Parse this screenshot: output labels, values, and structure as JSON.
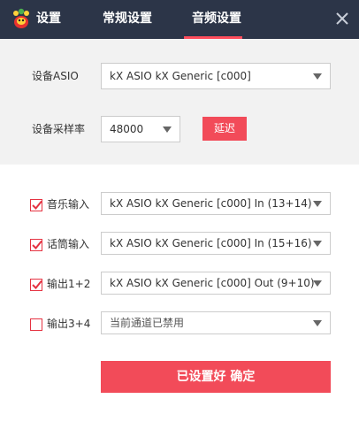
{
  "header": {
    "tabs": [
      {
        "label": "设置"
      },
      {
        "label": "常规设置"
      },
      {
        "label": "音频设置",
        "active": true
      }
    ]
  },
  "device": {
    "asio_label": "设备ASIO",
    "asio_value": "kX ASIO kX Generic [c000]",
    "rate_label": "设备采样率",
    "rate_value": "48000",
    "reset_label": "延迟"
  },
  "channels": [
    {
      "label": "音乐输入",
      "checked": true,
      "value": "kX ASIO kX Generic [c000] In (13+14)"
    },
    {
      "label": "话筒输入",
      "checked": true,
      "value": "kX ASIO kX Generic [c000] In (15+16)"
    },
    {
      "label": "输出1+2",
      "checked": true,
      "value": "kX ASIO kX Generic [c000] Out (9+10)"
    },
    {
      "label": "输出3+4",
      "checked": false,
      "value": "当前通道已禁用"
    }
  ],
  "confirm_label": "已设置好 确定",
  "colors": {
    "accent": "#f24b59",
    "titlebar": "#2c3548"
  }
}
